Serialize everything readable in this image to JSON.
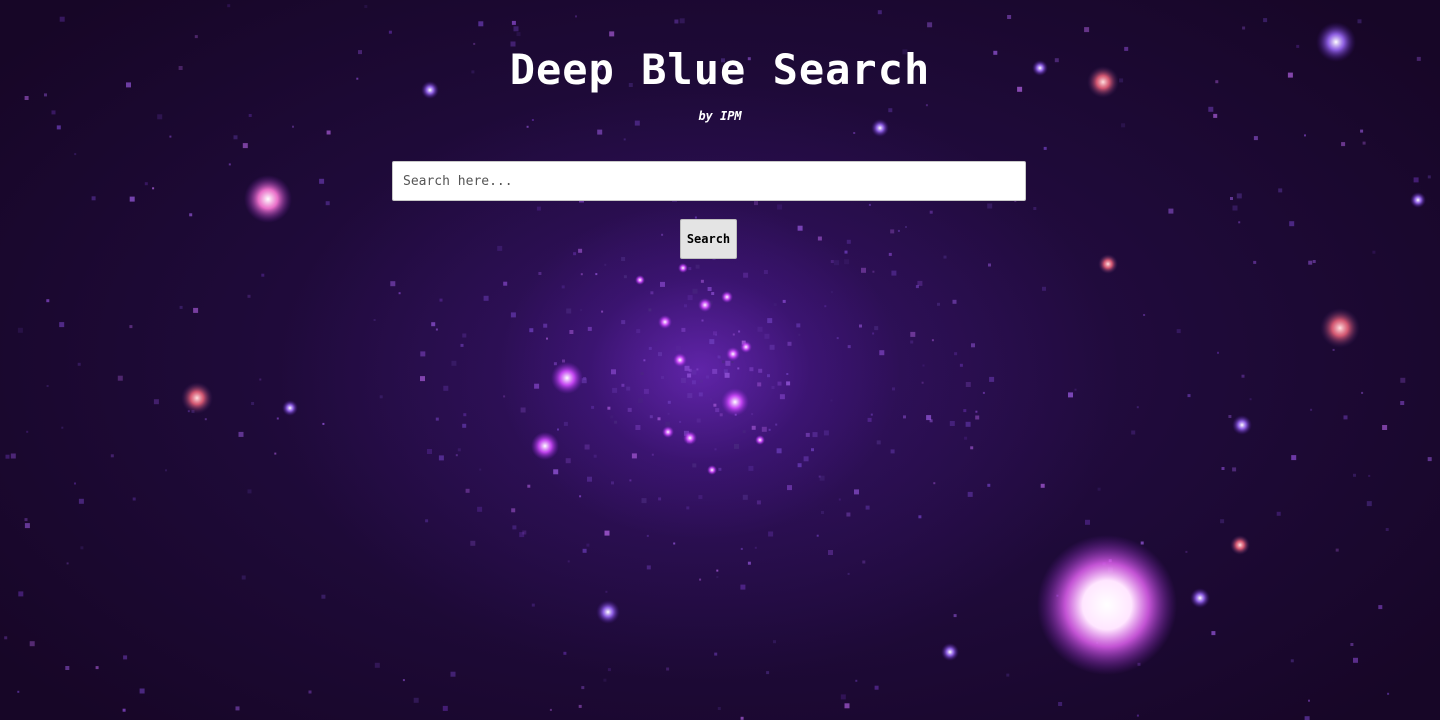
{
  "page": {
    "title": "Deep Blue Search",
    "subtitle": "by IPM"
  },
  "search": {
    "placeholder": "Search here...",
    "value": "",
    "button_label": "Search"
  },
  "background": {
    "description_icon": "galaxy-background-image",
    "colors": {
      "base": "#1e0a33",
      "glow": "#8232dc",
      "bright_star": "#ffffff"
    }
  }
}
